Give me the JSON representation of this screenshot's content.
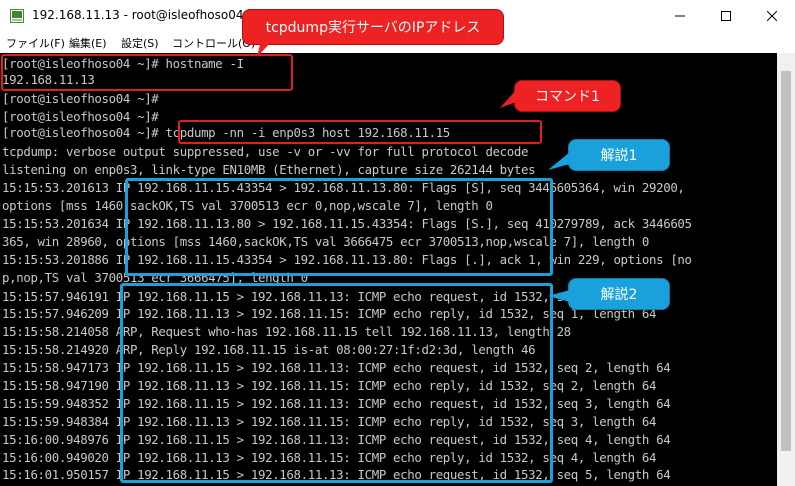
{
  "window": {
    "title": "192.168.11.13 - root@isleofhoso04:~ VT",
    "icon": "terminal-app-icon",
    "controls": [
      "minimize-icon",
      "maximize-icon",
      "close-icon"
    ]
  },
  "menu": {
    "items": [
      "ファイル(F)",
      "編集(E)",
      "設定(S)",
      "コントロール(O)"
    ]
  },
  "terminal": {
    "lines": [
      "[root@isleofhoso04 ~]# hostname -I",
      "192.168.11.13",
      "[root@isleofhoso04 ~]#",
      "[root@isleofhoso04 ~]#",
      "[root@isleofhoso04 ~]# tcpdump -nn -i enp0s3 host 192.168.11.15",
      "tcpdump: verbose output suppressed, use -v or -vv for full protocol decode",
      "listening on enp0s3, link-type EN10MB (Ethernet), capture size 262144 bytes",
      "15:15:53.201613 IP 192.168.11.15.43354 > 192.168.11.13.80: Flags [S], seq 3446605364, win 29200,",
      "options [mss 1460,sackOK,TS val 3700513 ecr 0,nop,wscale 7], length 0",
      "15:15:53.201634 IP 192.168.11.13.80 > 192.168.11.15.43354: Flags [S.], seq 410279789, ack 3446605",
      "365, win 28960, options [mss 1460,sackOK,TS val 3666475 ecr 3700513,nop,wscale 7], length 0",
      "15:15:53.201886 IP 192.168.11.15.43354 > 192.168.11.13.80: Flags [.], ack 1, win 229, options [no",
      "p,nop,TS val 3700513 ecr 3666475], length 0",
      "15:15:57.946191 IP 192.168.11.15 > 192.168.11.13: ICMP echo request, id 1532, seq 1, length 64",
      "15:15:57.946209 IP 192.168.11.13 > 192.168.11.15: ICMP echo reply, id 1532, seq 1, length 64",
      "15:15:58.214058 ARP, Request who-has 192.168.11.15 tell 192.168.11.13, length 28",
      "15:15:58.214920 ARP, Reply 192.168.11.15 is-at 08:00:27:1f:d2:3d, length 46",
      "15:15:58.947173 IP 192.168.11.15 > 192.168.11.13: ICMP echo request, id 1532, seq 2, length 64",
      "15:15:58.947190 IP 192.168.11.13 > 192.168.11.15: ICMP echo reply, id 1532, seq 2, length 64",
      "15:15:59.948352 IP 192.168.11.15 > 192.168.11.13: ICMP echo request, id 1532, seq 3, length 64",
      "15:15:59.948384 IP 192.168.11.13 > 192.168.11.15: ICMP echo reply, id 1532, seq 3, length 64",
      "15:16:00.948976 IP 192.168.11.15 > 192.168.11.13: ICMP echo request, id 1532, seq 4, length 64",
      "15:16:00.949020 IP 192.168.11.13 > 192.168.11.15: ICMP echo reply, id 1532, seq 4, length 64",
      "15:16:01.950157 IP 192.168.11.15 > 192.168.11.13: ICMP echo request, id 1532, seq 5, length 64"
    ]
  },
  "annotations": {
    "ip_callout": "tcpdump実行サーバのIPアドレス",
    "command_callout": "コマンド1",
    "explain1_callout": "解説1",
    "explain2_callout": "解説2"
  },
  "colors": {
    "terminal_bg": "#000000",
    "terminal_fg": "#c8c8c8",
    "highlight_red": "#e0201b",
    "highlight_blue": "#1aa0db"
  }
}
